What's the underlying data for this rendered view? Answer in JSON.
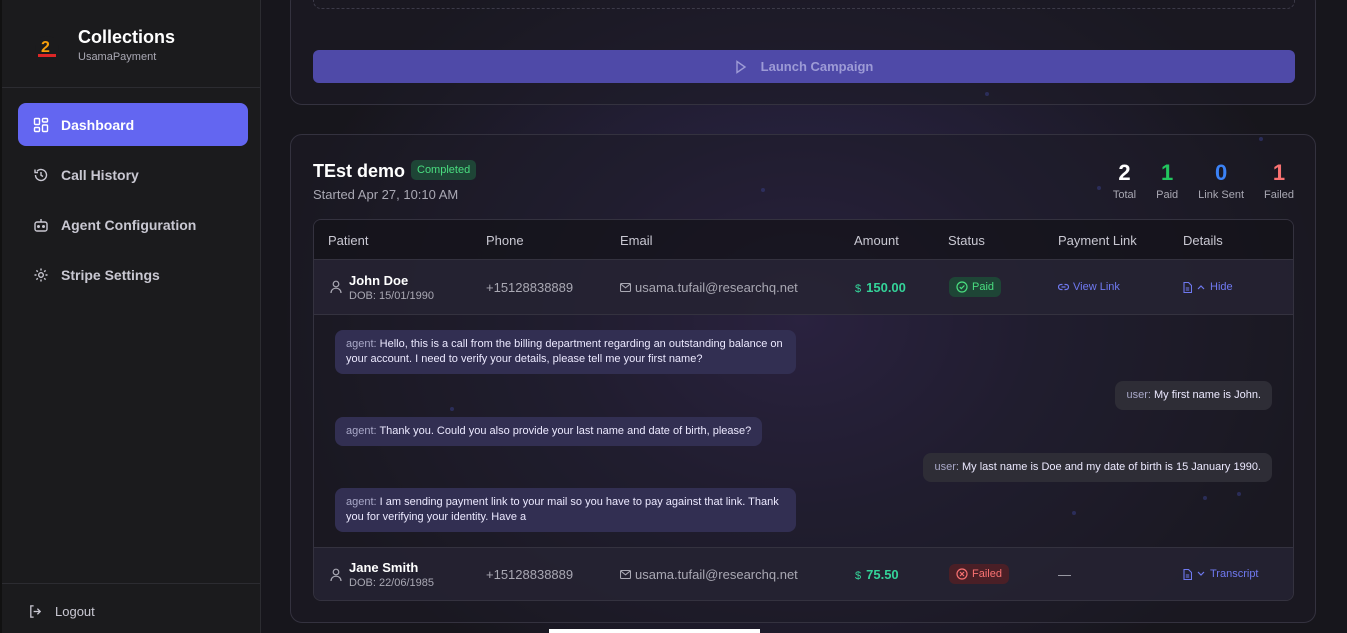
{
  "app": {
    "title": "Collections",
    "subtitle": "UsamaPayment"
  },
  "sidebar": {
    "items": [
      {
        "label": "Dashboard",
        "icon": "dashboard-icon",
        "active": true
      },
      {
        "label": "Call History",
        "icon": "history-icon",
        "active": false
      },
      {
        "label": "Agent Configuration",
        "icon": "bot-icon",
        "active": false
      },
      {
        "label": "Stripe Settings",
        "icon": "gear-icon",
        "active": false
      }
    ],
    "logout_label": "Logout"
  },
  "launch": {
    "label": "Launch Campaign"
  },
  "campaign": {
    "title": "TEst demo",
    "status_badge": "Completed",
    "started": "Started Apr 27, 10:10 AM",
    "stats": [
      {
        "value": "2",
        "label": "Total",
        "color": "#ffffff"
      },
      {
        "value": "1",
        "label": "Paid",
        "color": "#22c55e"
      },
      {
        "value": "0",
        "label": "Link Sent",
        "color": "#3b82f6"
      },
      {
        "value": "1",
        "label": "Failed",
        "color": "#f87171"
      }
    ]
  },
  "table": {
    "headers": [
      "Patient",
      "Phone",
      "Email",
      "Amount",
      "Status",
      "Payment Link",
      "Details"
    ],
    "rows": [
      {
        "name": "John Doe",
        "dob": "DOB: 15/01/1990",
        "phone": "+15128838889",
        "email": "usama.tufail@researchq.net",
        "amount": "150.00",
        "status": "Paid",
        "payment_link": "View Link",
        "details": "Hide"
      },
      {
        "name": "Jane Smith",
        "dob": "DOB: 22/06/1985",
        "phone": "+15128838889",
        "email": "usama.tufail@researchq.net",
        "amount": "75.50",
        "status": "Failed",
        "payment_link": "—",
        "details": "Transcript"
      }
    ]
  },
  "transcript": [
    {
      "speaker": "agent:",
      "text": "Hello, this is a call from the billing department regarding an outstanding balance on your account. I need to verify your details, please tell me your first name?"
    },
    {
      "speaker": "user:",
      "text": "My first name is John."
    },
    {
      "speaker": "agent:",
      "text": "Thank you. Could you also provide your last name and date of birth, please?"
    },
    {
      "speaker": "user:",
      "text": "My last name is Doe and my date of birth is 15 January 1990."
    },
    {
      "speaker": "agent:",
      "text": "I am sending payment link to your mail so you have to pay against that link. Thank you for verifying your identity. Have a"
    }
  ],
  "currency_symbol": "$"
}
